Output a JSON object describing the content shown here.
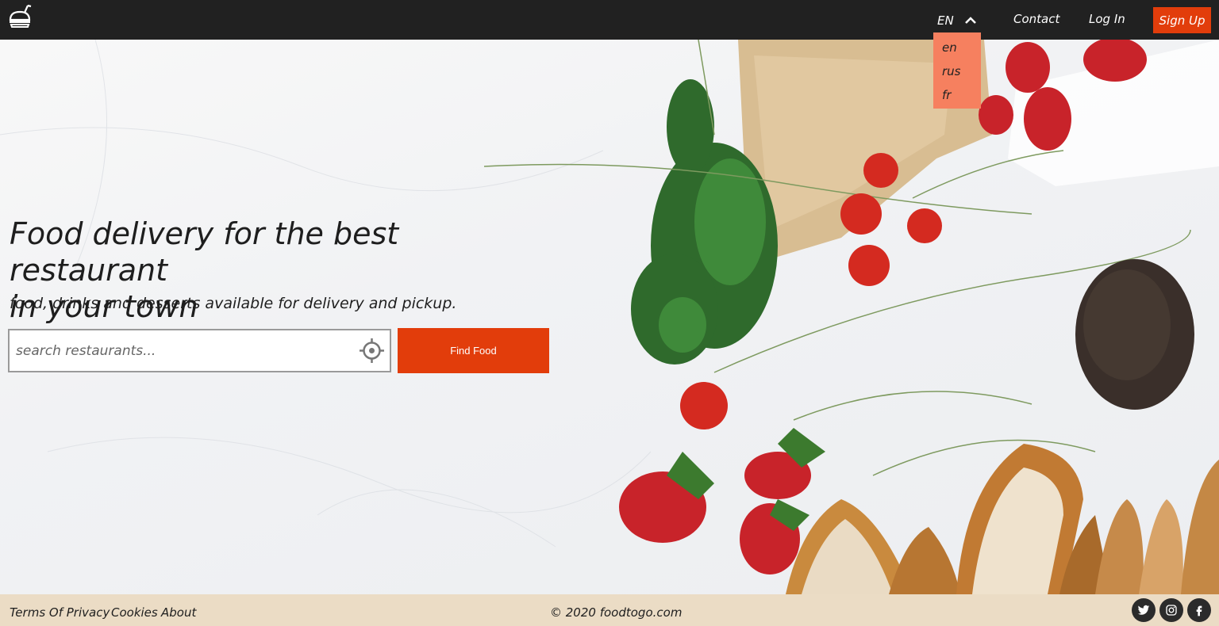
{
  "header": {
    "language_current": "EN",
    "language_options": [
      "en",
      "rus",
      "fr"
    ],
    "nav": {
      "contact": "Contact",
      "login": "Log In",
      "signup": "Sign Up"
    }
  },
  "hero": {
    "headline_line1": "Food delivery for the best restaurant",
    "headline_line2": "in your town",
    "subtitle": "food, drinks and desserts available for delivery and pickup.",
    "search_placeholder": "search restaurants...",
    "search_value": "",
    "find_button": "Find Food"
  },
  "footer": {
    "terms": "Terms Of Privacy",
    "cookies": "Cookies",
    "about": "About",
    "copyright": "© 2020 foodtogo.com",
    "social": [
      "twitter-icon",
      "instagram-icon",
      "facebook-icon"
    ]
  },
  "colors": {
    "header_bg": "#212121",
    "accent": "#e23d0b",
    "dropdown_bg": "#f6805f",
    "footer_bg": "#ebdcc5"
  }
}
